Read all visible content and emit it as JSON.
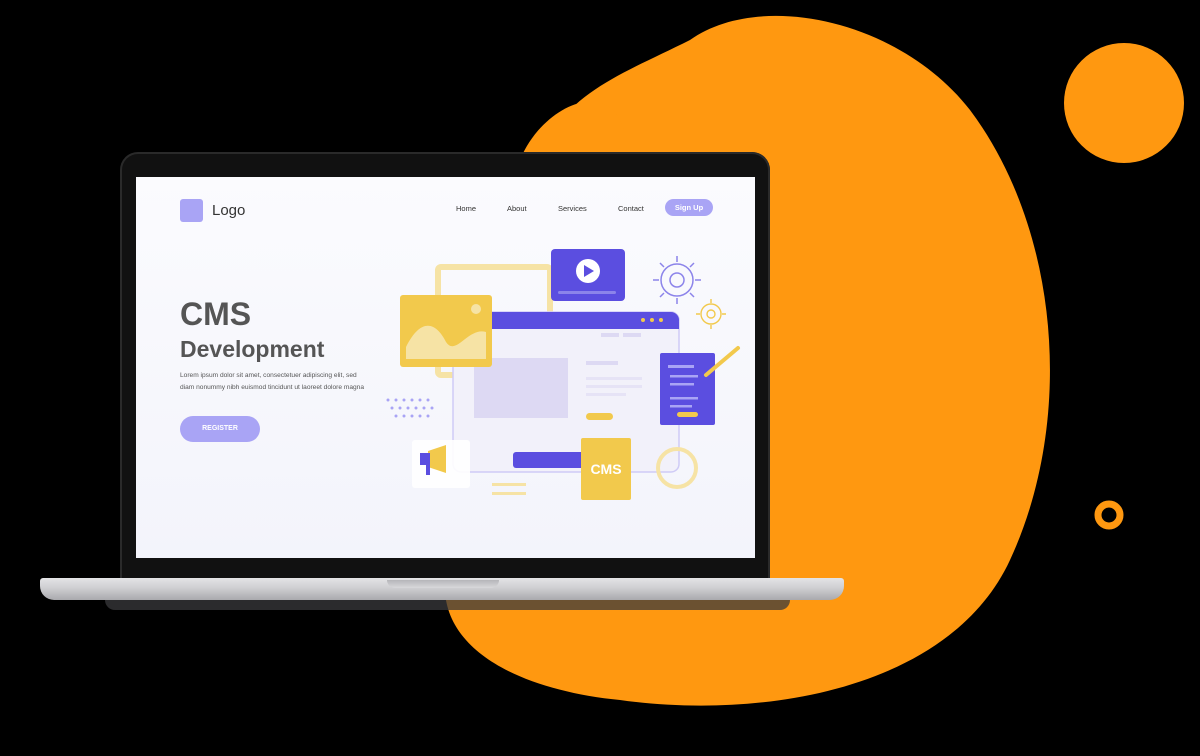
{
  "colors": {
    "accent_orange": "#ff9810",
    "primary_purple": "#5b4ee0",
    "soft_purple": "#a9a4f5",
    "yellow": "#f2c94c"
  },
  "site": {
    "logo_text": "Logo",
    "nav": [
      "Home",
      "About",
      "Services",
      "Contact"
    ],
    "signup_label": "Sign Up"
  },
  "hero": {
    "title_line1": "CMS",
    "title_line2": "Development",
    "description": "Lorem ipsum dolor sit amet, consectetuer adipiscing elit, sed diam nonummy nibh euismod tincidunt ut laoreet dolore magna",
    "register_label": "REGISTER"
  },
  "illustration": {
    "cms_label": "CMS",
    "icons": [
      "play-icon",
      "gear-icon",
      "image-icon",
      "megaphone-icon",
      "pencil-icon",
      "document-icon"
    ]
  }
}
